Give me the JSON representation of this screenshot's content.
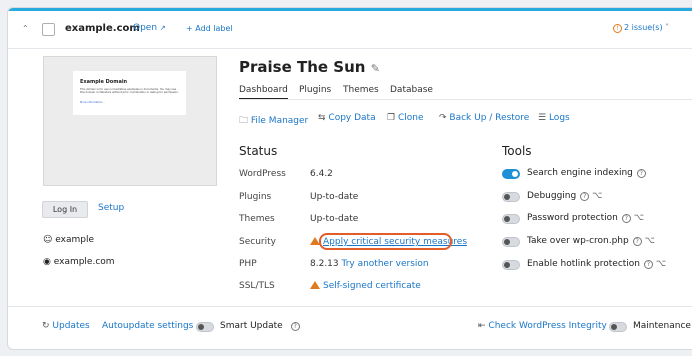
{
  "header": {
    "domain": "example.com",
    "open_label": "Open",
    "add_label": "+ Add label",
    "issues": "2 issue(s)"
  },
  "preview": {
    "title": "Example Domain",
    "text": "This domain is for use in illustrative examples in documents. You may use this domain in literature without prior coordination or asking for permission.",
    "more": "More information..."
  },
  "left": {
    "login": "Log In",
    "setup": "Setup",
    "user": "example",
    "site": "example.com"
  },
  "site": {
    "title": "Praise The Sun",
    "tabs": [
      "Dashboard",
      "Plugins",
      "Themes",
      "Database"
    ]
  },
  "actions": [
    "File Manager",
    "Copy Data",
    "Clone",
    "Back Up / Restore",
    "Logs"
  ],
  "status": {
    "heading": "Status",
    "rows": [
      {
        "label": "WordPress",
        "value": "6.4.2"
      },
      {
        "label": "Plugins",
        "value": "Up-to-date"
      },
      {
        "label": "Themes",
        "value": "Up-to-date"
      },
      {
        "label": "Security",
        "value": "Apply critical security measures"
      },
      {
        "label": "PHP",
        "value": "8.2.13",
        "link": "Try another version"
      },
      {
        "label": "SSL/TLS",
        "value": "Self-signed certificate"
      }
    ]
  },
  "tools": {
    "heading": "Tools",
    "items": [
      {
        "label": "Search engine indexing",
        "on": true
      },
      {
        "label": "Debugging",
        "on": false
      },
      {
        "label": "Password protection",
        "on": false
      },
      {
        "label": "Take over wp-cron.php",
        "on": false
      },
      {
        "label": "Enable hotlink protection",
        "on": false
      }
    ]
  },
  "footer": {
    "updates": "Updates",
    "autoupdate": "Autoupdate settings",
    "smart_update": "Smart Update",
    "check": "Check WordPress Integrity",
    "maintenance": "Maintenance"
  },
  "colors": {
    "accent": "#1a76c7",
    "warning": "#e07a1f",
    "highlight": "#e35d2a"
  }
}
